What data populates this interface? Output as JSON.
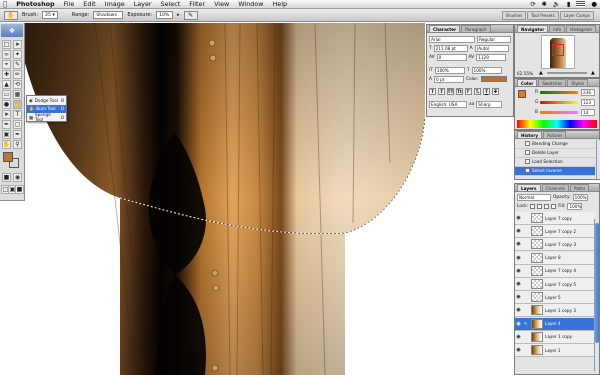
{
  "menubar": {
    "app": "Photoshop",
    "items": [
      "File",
      "Edit",
      "Image",
      "Layer",
      "Select",
      "Filter",
      "View",
      "Window",
      "Help"
    ]
  },
  "options": {
    "brush_label": "Brush:",
    "brush_size": "25",
    "range_label": "Range:",
    "range_value": "Shadows",
    "exposure_label": "Exposure:",
    "exposure_value": "10%",
    "wells": [
      "Brushes",
      "Tool Presets",
      "Layer Comps"
    ]
  },
  "toolbox": {
    "flyout": [
      {
        "label": "Dodge Tool",
        "key": "O"
      },
      {
        "label": "Burn Tool",
        "key": "O"
      },
      {
        "label": "Sponge Tool",
        "key": "O"
      }
    ],
    "foreground_color": "#b0773a",
    "background_color": "#ffffff"
  },
  "character": {
    "tabs": [
      "Character",
      "Paragraph"
    ],
    "font": "Arial",
    "style": "Regular",
    "size": "211.08 pt",
    "leading": "(Auto)",
    "kerning": "0",
    "tracking": "1129",
    "vscale": "100%",
    "hscale": "100%",
    "baseline": "0 pt",
    "color_label": "Color:",
    "color": "#b8722e",
    "format_buttons": [
      "T",
      "T",
      "TT",
      "Tt",
      "T'",
      "T,",
      "T",
      "T"
    ],
    "language": "English: USA",
    "antialias_icon": "aa-icon",
    "antialias": "Sharp"
  },
  "navigator": {
    "tabs": [
      "Navigator",
      "Info",
      "Histogram"
    ],
    "zoom": "62.55%"
  },
  "color": {
    "tabs": [
      "Color",
      "Swatches",
      "Styles"
    ],
    "r_label": "R",
    "r": "236",
    "g_label": "G",
    "g": "123",
    "b_label": "B",
    "b": "14"
  },
  "history": {
    "tabs": [
      "History",
      "Actions"
    ],
    "items": [
      "Blending Change",
      "Delete Layer",
      "Load Selection",
      "Select Inverse"
    ]
  },
  "layers": {
    "tabs": [
      "Layers",
      "Channels",
      "Paths"
    ],
    "blend_mode": "Normal",
    "opacity_label": "Opacity:",
    "opacity": "100%",
    "lock_label": "Lock:",
    "fill_label": "Fill:",
    "fill": "100%",
    "rows": [
      {
        "name": "Layer 7 copy",
        "thumb": "transparent"
      },
      {
        "name": "Layer 7 copy 2",
        "thumb": "transparent"
      },
      {
        "name": "Layer 7 copy 3",
        "thumb": "transparent"
      },
      {
        "name": "Layer 8",
        "thumb": "transparent"
      },
      {
        "name": "Layer 7 copy 4",
        "thumb": "transparent"
      },
      {
        "name": "Layer 7 copy 5",
        "thumb": "transparent"
      },
      {
        "name": "Layer 5",
        "thumb": "transparent"
      },
      {
        "name": "Layer 1 copy 3",
        "thumb": "image"
      },
      {
        "name": "Layer 4",
        "thumb": "image",
        "selected": true
      },
      {
        "name": "Layer 1 copy",
        "thumb": "image"
      },
      {
        "name": "Layer 1",
        "thumb": "image"
      }
    ]
  }
}
